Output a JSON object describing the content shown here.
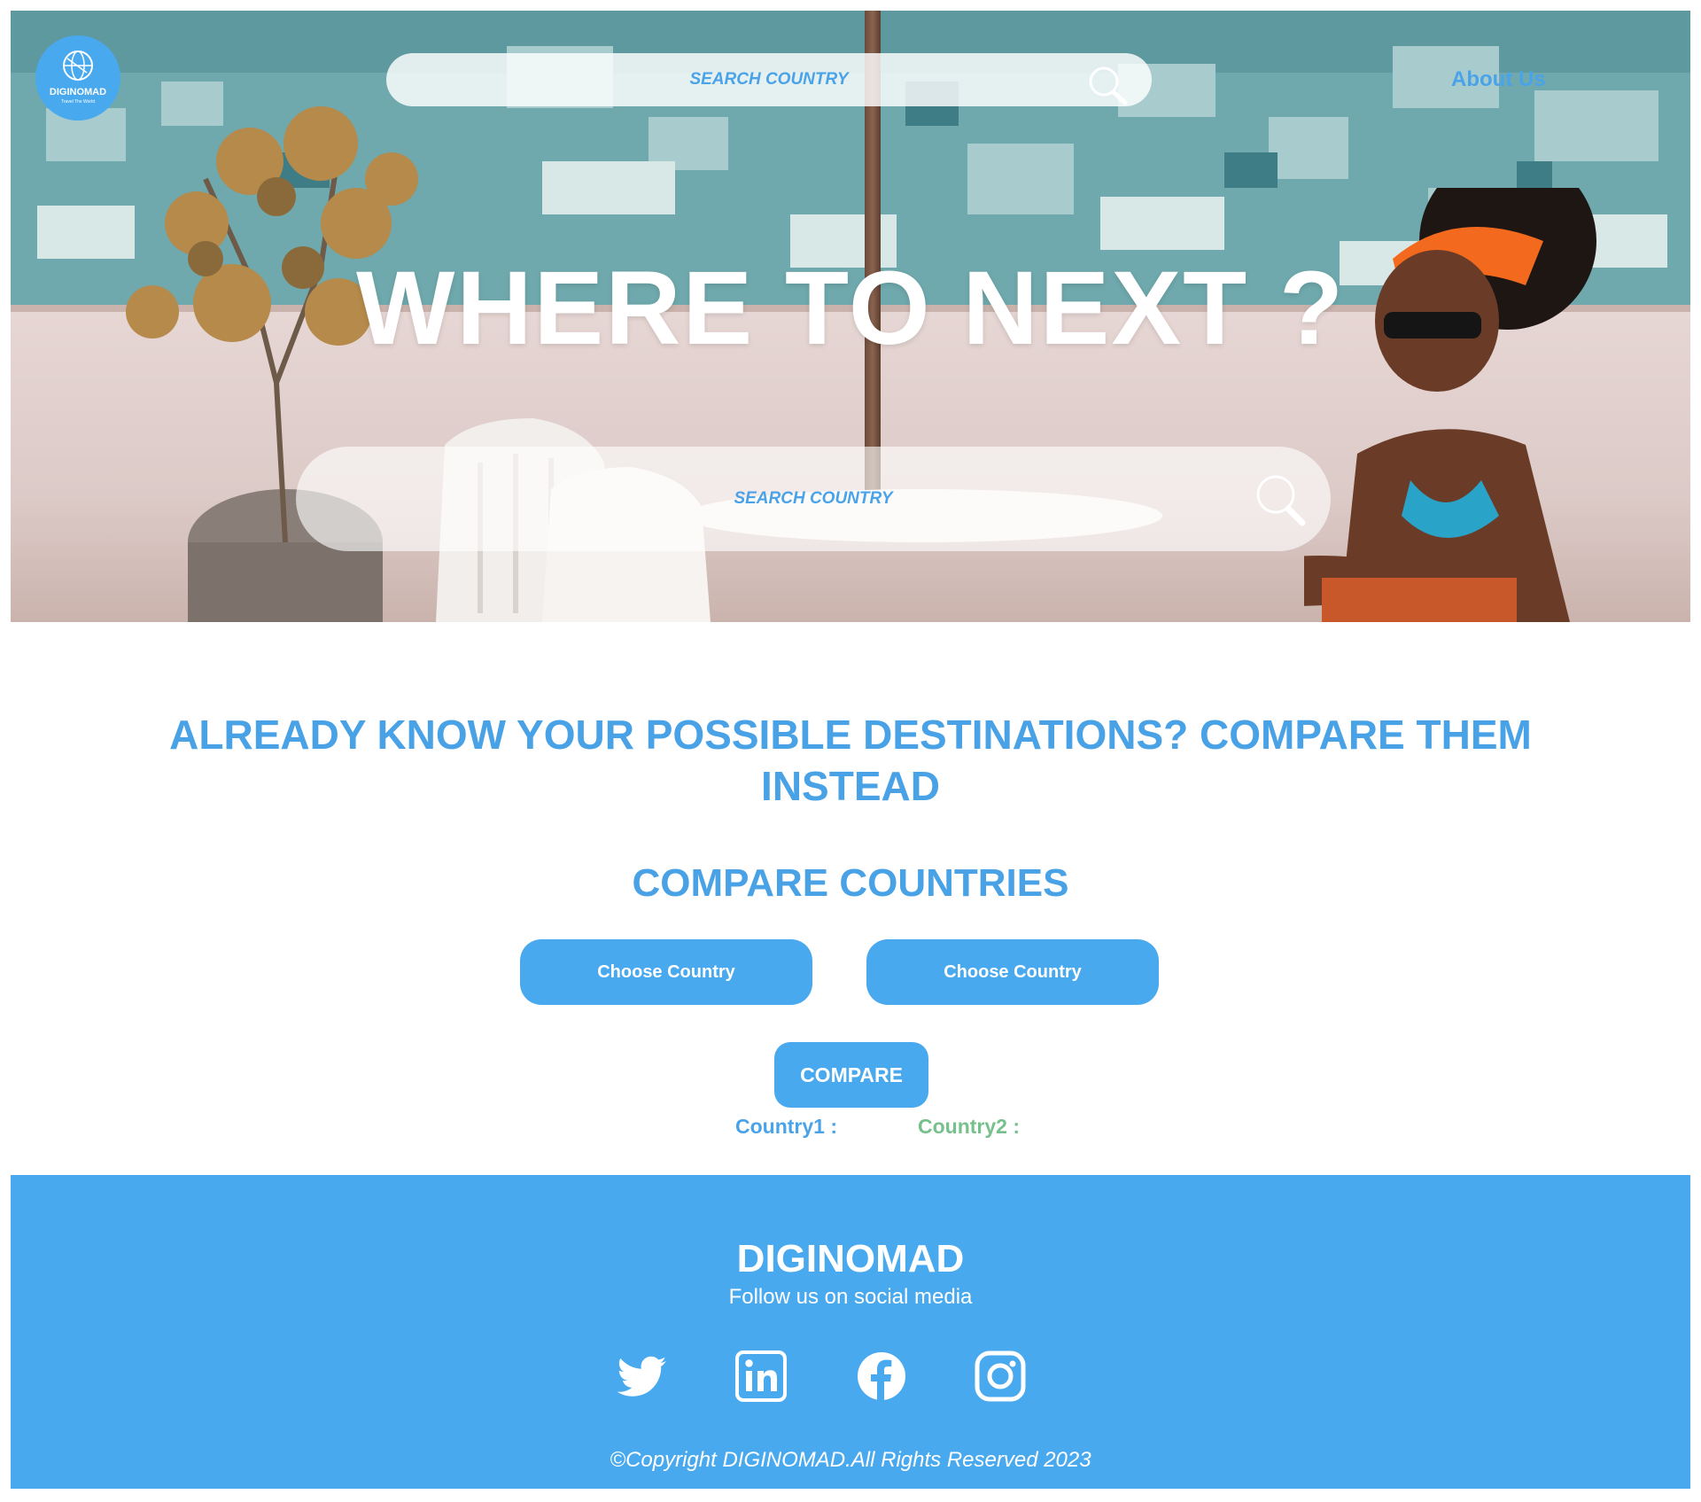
{
  "brand": {
    "logo_name": "DIGINOMAD",
    "logo_tagline": "Travel The World",
    "accent_color": "#49a9ee"
  },
  "header": {
    "search_text": "SEARCH COUNTRY",
    "about_label": "About Us"
  },
  "hero": {
    "title": "WHERE TO NEXT ?",
    "search_text": "SEARCH COUNTRY"
  },
  "compare": {
    "heading": "ALREADY KNOW YOUR POSSIBLE DESTINATIONS? COMPARE THEM INSTEAD",
    "subheading": "COMPARE COUNTRIES",
    "choose_buttons": [
      "Choose Country",
      "Choose Country"
    ],
    "compare_label": "COMPARE",
    "country1_label": "Country1 :",
    "country2_label": "Country2 :",
    "country2_color": "#76c08c"
  },
  "footer": {
    "brand": "DIGINOMAD",
    "follow": "Follow us on social media",
    "social": [
      "twitter-icon",
      "linkedin-icon",
      "facebook-icon",
      "instagram-icon"
    ],
    "copyright": "©Copyright DIGINOMAD.All Rights Reserved 2023"
  }
}
